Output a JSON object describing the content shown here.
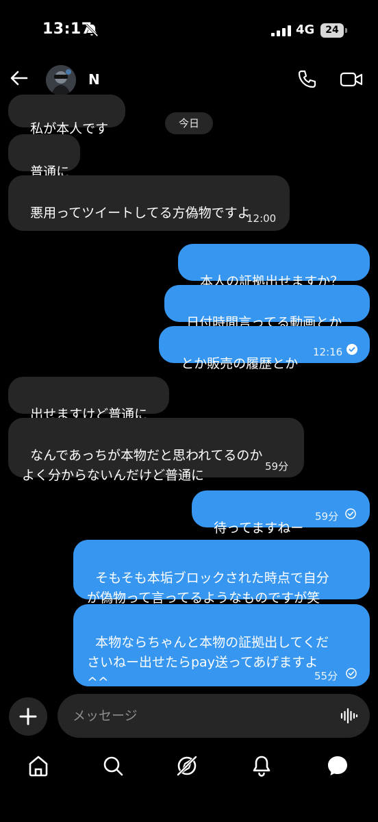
{
  "status_bar": {
    "time": "13:17",
    "network": "4G",
    "battery": "24"
  },
  "header": {
    "contact_name": "N"
  },
  "day_separator": "今日",
  "messages": [
    {
      "dir": "in",
      "text": "私が本人です"
    },
    {
      "dir": "in",
      "text": "普通に"
    },
    {
      "dir": "in",
      "text": "悪用ってツイートしてる方偽物ですよ",
      "time": "12:00"
    },
    {
      "dir": "out",
      "text": "本人の証拠出せますか？"
    },
    {
      "dir": "out",
      "text": "日付時間言ってる動画とか"
    },
    {
      "dir": "out",
      "text": "とか販売の履歴とか",
      "time": "12:16",
      "read": true
    },
    {
      "dir": "in",
      "text": "出せますけど普通に"
    },
    {
      "dir": "in",
      "text": "なんであっちが本物だと思われてるのか\nよく分からないんだけど普通に",
      "time": "59分"
    },
    {
      "dir": "out",
      "text": "待ってますねー",
      "time": "59分",
      "read": true
    },
    {
      "dir": "out",
      "text": "そもそも本垢ブロックされた時点で自分\nが偽物って言ってるようなものですが笑"
    },
    {
      "dir": "out",
      "text": "本物ならちゃんと本物の証拠出してくだ\nさいねー出せたらpay送ってあげますよ\n^^",
      "time": "55分",
      "read": true
    }
  ],
  "composer": {
    "placeholder": "メッセージ"
  },
  "colors": {
    "outgoing_bubble": "#3797f0",
    "incoming_bubble": "#262626",
    "background": "#000000"
  },
  "bottom_nav": [
    "home-icon",
    "search-icon",
    "explore-icon",
    "notifications-icon",
    "messages-icon"
  ]
}
